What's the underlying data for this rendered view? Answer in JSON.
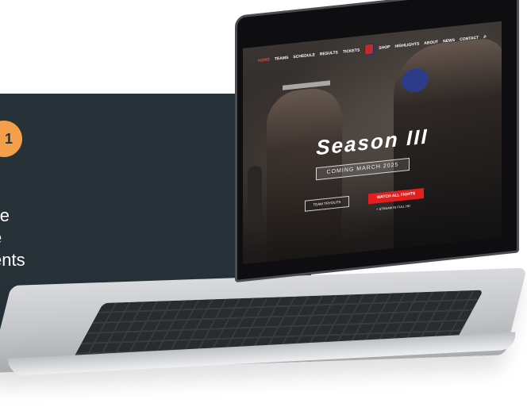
{
  "promo": {
    "step_number": "1",
    "text_lines": [
      "ile",
      "e",
      "ents"
    ]
  },
  "site": {
    "nav": [
      "HOME",
      "TEAMS",
      "SCHEDULE",
      "RESULTS",
      "TICKETS",
      "SHOP",
      "HIGHLIGHTS",
      "ABOUT",
      "NEWS",
      "CONTACT"
    ],
    "active_nav": "HOME",
    "hero_title": "Season III",
    "hero_subtitle": "COMING MARCH 2025",
    "button_tryouts": "TEAM TRYOUTS",
    "button_watch": "WATCH ALL FIGHTS",
    "stream_note": "+ STREAM IN FULL HD"
  },
  "colors": {
    "panel": "#263138",
    "badge": "#f4a04b",
    "accent_red": "#e21e1e"
  }
}
